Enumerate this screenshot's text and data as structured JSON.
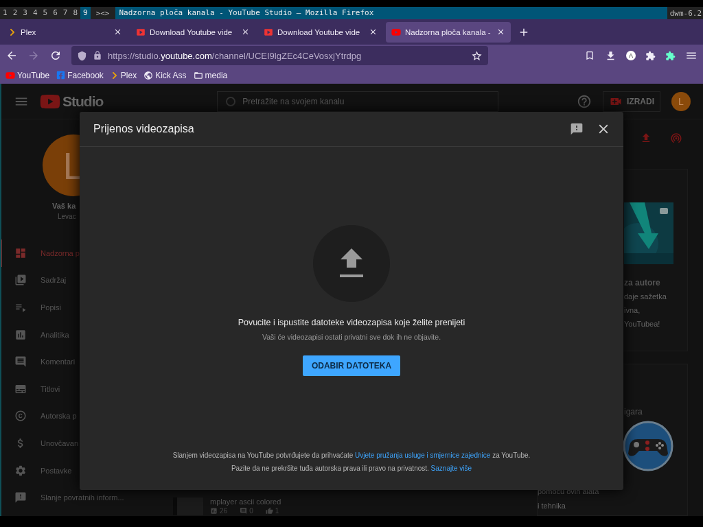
{
  "wm_bar": {
    "tags": [
      {
        "label": "1",
        "selected": false
      },
      {
        "label": "2",
        "selected": false
      },
      {
        "label": "3",
        "selected": false
      },
      {
        "label": "4",
        "selected": false
      },
      {
        "label": "5",
        "selected": false
      },
      {
        "label": "6",
        "selected": false
      },
      {
        "label": "7",
        "selected": false
      },
      {
        "label": "8",
        "selected": false
      },
      {
        "label": "9",
        "selected": true
      }
    ],
    "layout": "><>",
    "title": "Nadzorna ploča kanala - YouTube Studio — Mozilla Firefox",
    "status": "dwm-6.2"
  },
  "browser": {
    "tabs": [
      {
        "label": "Plex",
        "kind": "plex",
        "selected": false
      },
      {
        "label": "Download Youtube vide",
        "kind": "video",
        "selected": false
      },
      {
        "label": "Download Youtube vide",
        "kind": "video",
        "selected": false
      },
      {
        "label": "Nadzorna ploča kanala -",
        "kind": "youtube",
        "selected": true
      }
    ],
    "url": {
      "prefix": "https://studio.",
      "domain": "youtube.com",
      "path": "/channel/UCEI9lgZEc4CeVosxjYtrdpg"
    },
    "account_initial": "A",
    "bookmarks": [
      {
        "label": "YouTube",
        "kind": "youtube"
      },
      {
        "label": "Facebook",
        "kind": "facebook"
      },
      {
        "label": "Plex",
        "kind": "plex"
      },
      {
        "label": "Kick Ass",
        "kind": "globe"
      },
      {
        "label": "media",
        "kind": "folder"
      }
    ]
  },
  "studio": {
    "logo": "Studio",
    "search": {
      "placeholder": "Pretražite na svojem kanalu"
    },
    "create_button": "IZRADI",
    "avatar": "L",
    "sidebar": {
      "avatar": "L",
      "channel_title": "Vaš ka",
      "channel_name": "Levac",
      "items": [
        {
          "label": "Nadzorna p",
          "kind": "dashboard",
          "selected": true
        },
        {
          "label": "Sadržaj",
          "kind": "content",
          "selected": false
        },
        {
          "label": "Popisi",
          "kind": "playlist",
          "selected": false
        },
        {
          "label": "Analitika",
          "kind": "analytics",
          "selected": false
        },
        {
          "label": "Komentari",
          "kind": "comments",
          "selected": false
        },
        {
          "label": "Titlovi",
          "kind": "subtitles",
          "selected": false
        },
        {
          "label": "Autorska p",
          "kind": "copyright",
          "selected": false
        },
        {
          "label": "Unovčavan",
          "kind": "money",
          "selected": false
        },
        {
          "label": "Postavke",
          "kind": "settings",
          "selected": false
        },
        {
          "label": "Slanje povratnih inform...",
          "kind": "feedback",
          "selected": false
        }
      ]
    },
    "cards": [
      {
        "kind": "news",
        "title": "za autore",
        "lines": [
          "daje sažetka",
          "ivna,",
          "YouTubea!"
        ]
      },
      {
        "kind": "game",
        "title": "igara",
        "lines": [
          "pomoću ovih alata",
          "i tehnika"
        ]
      }
    ],
    "recent_video": {
      "title": "mplayer ascii colored",
      "views": "26",
      "comments": "0",
      "likes": "1"
    }
  },
  "dialog": {
    "title": "Prijenos videozapisa",
    "prompt": "Povucite i ispustite datoteke videozapisa koje želite prenijeti",
    "note": "Vaši će videozapisi ostati privatni sve dok ih ne objavite.",
    "button": "ODABIR DATOTEKA",
    "terms": {
      "before": "Slanjem videozapisa na YouTube potvrđujete da prihvaćate",
      "link": "Uvjete pružanja usluge i smjernice zajednice",
      "after": "za YouTube."
    },
    "privacy": {
      "before": "Pazite da ne prekršite tuđa autorska prava ili pravo na privatnost.",
      "link": "Saznajte više"
    }
  }
}
